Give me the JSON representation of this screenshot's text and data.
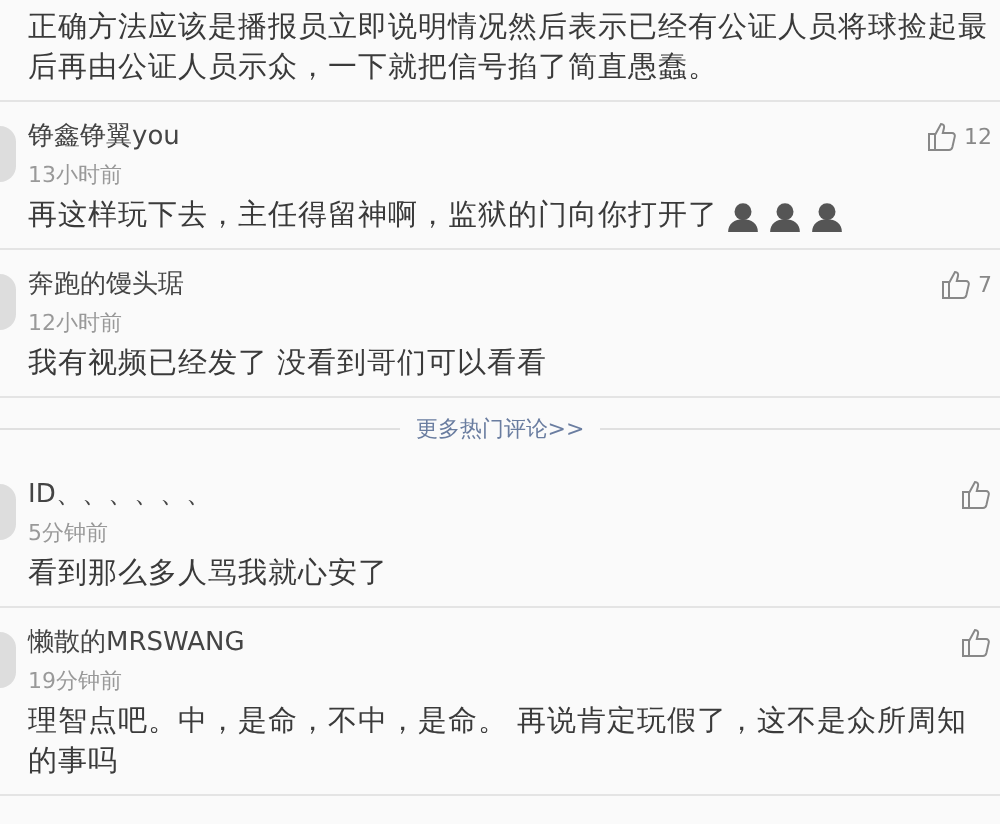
{
  "top_comment": {
    "text": "正确方法应该是播报员立即说明情况然后表示已经有公证人员将球捡起最后再由公证人员示众，一下就把信号掐了简直愚蠢。"
  },
  "comments": [
    {
      "user": "铮鑫铮翼you",
      "time": "13小时前",
      "text": "再这样玩下去，主任得留神啊，监狱的门向你打开了",
      "emojis": [
        {
          "kind": "person"
        },
        {
          "kind": "person"
        },
        {
          "kind": "person"
        }
      ],
      "likes": "12"
    },
    {
      "user": "奔跑的馒头琚",
      "time": "12小时前",
      "text": "我有视频已经发了 没看到哥们可以看看",
      "likes": "7"
    }
  ],
  "more_link": "更多热门评论>>",
  "latest": [
    {
      "user": "ID、、、、、、",
      "time": "5分钟前",
      "text": "看到那么多人骂我就心安了"
    },
    {
      "user": "懒散的MRSWANG",
      "time": "19分钟前",
      "text": "理智点吧。中，是命，不中，是命。 再说肯定玩假了，这不是众所周知的事吗"
    }
  ]
}
